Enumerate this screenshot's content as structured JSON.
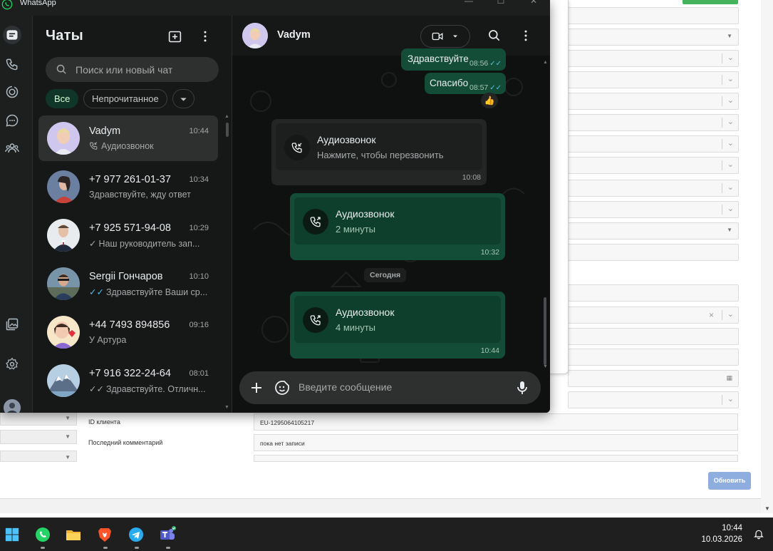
{
  "colors": {
    "accent_green": "#25d366",
    "outgoing_bubble": "#144d37",
    "incoming_bubble": "#242626",
    "read_ticks": "#53bdeb",
    "update_button": "#8faee0"
  },
  "window": {
    "title": "WhatsApp",
    "controls": [
      "minimize-icon",
      "maximize-icon",
      "close-icon"
    ]
  },
  "rail": {
    "items": [
      "chats-icon",
      "calls-icon",
      "status-icon",
      "channels-icon",
      "communities-icon",
      "media-icon",
      "settings-icon",
      "profile-avatar"
    ]
  },
  "chatlist": {
    "title": "Чаты",
    "search_placeholder": "Поиск или новый чат",
    "filters": {
      "all": "Все",
      "unread": "Непрочитанное"
    },
    "chats": [
      {
        "name": "Vadym",
        "time": "10:44",
        "preview_icon": "phone-incoming-icon",
        "preview": "Аудиозвонок"
      },
      {
        "name": "+7 977 261-01-37",
        "time": "10:34",
        "preview": "Здравствуйте, жду ответ"
      },
      {
        "name": "+7 925 571-94-08",
        "time": "10:29",
        "tick": "single",
        "preview": "Наш руководитель зап..."
      },
      {
        "name": "Sergii Гончаров",
        "time": "10:10",
        "tick": "double-blue",
        "preview": "Здравствуйте Ваши ср..."
      },
      {
        "name": "+44 7493 894856",
        "time": "09:16",
        "preview": "У Артура"
      },
      {
        "name": "+7 916 322-24-64",
        "time": "08:01",
        "tick": "double-grey",
        "preview": "Здравствуйте. Отличн..."
      }
    ]
  },
  "conversation": {
    "contact": "Vadym",
    "messages": {
      "m1": {
        "text": "Здравствуйте",
        "time": "08:56"
      },
      "m2": {
        "text": "Спасибо",
        "time": "08:57",
        "reaction": "👍"
      },
      "m3": {
        "title": "Аудиозвонок",
        "subtitle": "Нажмите, чтобы перезвонить",
        "time": "10:08"
      },
      "m4": {
        "title": "Аудиозвонок",
        "subtitle": "2 минуты",
        "time": "10:32"
      },
      "m5": {
        "title": "Аудиозвонок",
        "subtitle": "4 минуты",
        "time": "10:44"
      }
    },
    "day_separator": "Сегодня",
    "composer_placeholder": "Введите сообщение"
  },
  "background_form": {
    "client_id_label": "ID клиента",
    "client_id_value": "EU-1295064105217",
    "last_comment_label": "Последний комментарий",
    "last_comment_value": "пока нет записи",
    "update_button": "Обновить"
  },
  "taskbar": {
    "apps": [
      "windows-start-icon",
      "whatsapp-icon",
      "file-explorer-icon",
      "brave-icon",
      "telegram-icon",
      "teams-icon"
    ],
    "time": "10:44",
    "date": "10.03.2026"
  }
}
